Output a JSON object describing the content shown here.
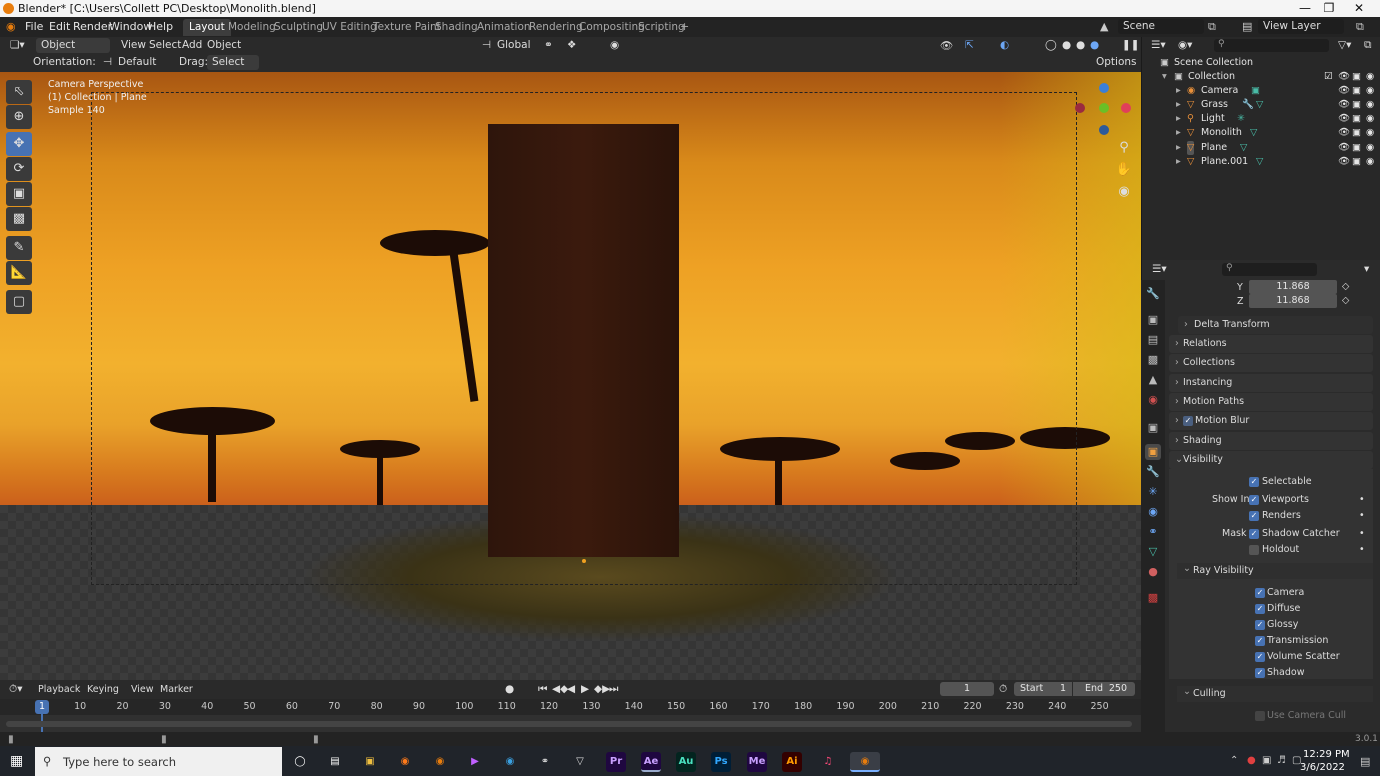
{
  "titlebar": {
    "title": "Blender* [C:\\Users\\Collett PC\\Desktop\\Monolith.blend]"
  },
  "menu": {
    "items": [
      "File",
      "Edit",
      "Render",
      "Window",
      "Help"
    ],
    "workspaces": [
      "Layout",
      "Modeling",
      "Sculpting",
      "UV Editing",
      "Texture Paint",
      "Shading",
      "Animation",
      "Rendering",
      "Compositing",
      "Scripting"
    ],
    "scene": "Scene",
    "view_layer": "View Layer"
  },
  "viewport_header": {
    "mode": "Object Mode",
    "view": "View",
    "select": "Select",
    "add": "Add",
    "object": "Object",
    "transform": "Global",
    "orientation_label": "Orientation:",
    "orientation": "Default",
    "drag_label": "Drag:",
    "drag": "Select Box",
    "options": "Options"
  },
  "viewport_overlay": {
    "line1": "Camera Perspective",
    "line2": "(1) Collection | Plane",
    "line3": "Sample 140"
  },
  "outliner": {
    "root": "Scene Collection",
    "collection": "Collection",
    "items": [
      "Camera",
      "Grass",
      "Light",
      "Monolith",
      "Plane",
      "Plane.001"
    ]
  },
  "properties": {
    "y_label": "Y",
    "y_value": "11.868",
    "z_label": "Z",
    "z_value": "11.868",
    "panels": [
      "Delta Transform",
      "Relations",
      "Collections",
      "Instancing",
      "Motion Paths",
      "Motion Blur",
      "Shading",
      "Visibility"
    ],
    "visibility": {
      "selectable": "Selectable",
      "show_in": "Show In",
      "viewports": "Viewports",
      "renders": "Renders",
      "mask": "Mask",
      "shadow_catcher": "Shadow Catcher",
      "holdout": "Holdout"
    },
    "ray_visibility": {
      "title": "Ray Visibility",
      "items": [
        "Camera",
        "Diffuse",
        "Glossy",
        "Transmission",
        "Volume Scatter",
        "Shadow"
      ]
    },
    "culling": {
      "title": "Culling",
      "use_camera_cull": "Use Camera Cull"
    }
  },
  "timeline": {
    "playback": "Playback",
    "keying": "Keying",
    "view": "View",
    "marker": "Marker",
    "current_frame": "1",
    "start_label": "Start",
    "start": "1",
    "end_label": "End",
    "end": "250",
    "ticks": [
      "1",
      "10",
      "20",
      "30",
      "40",
      "50",
      "60",
      "70",
      "80",
      "90",
      "100",
      "110",
      "120",
      "130",
      "140",
      "150",
      "160",
      "170",
      "180",
      "190",
      "200",
      "210",
      "220",
      "230",
      "240",
      "250"
    ]
  },
  "status": {
    "version": "3.0.1"
  },
  "taskbar": {
    "search_placeholder": "Type here to search",
    "time": "12:29 PM",
    "date": "3/6/2022",
    "apps": [
      "Pr",
      "Ae",
      "Au",
      "Ps",
      "Me",
      "Ai"
    ]
  }
}
